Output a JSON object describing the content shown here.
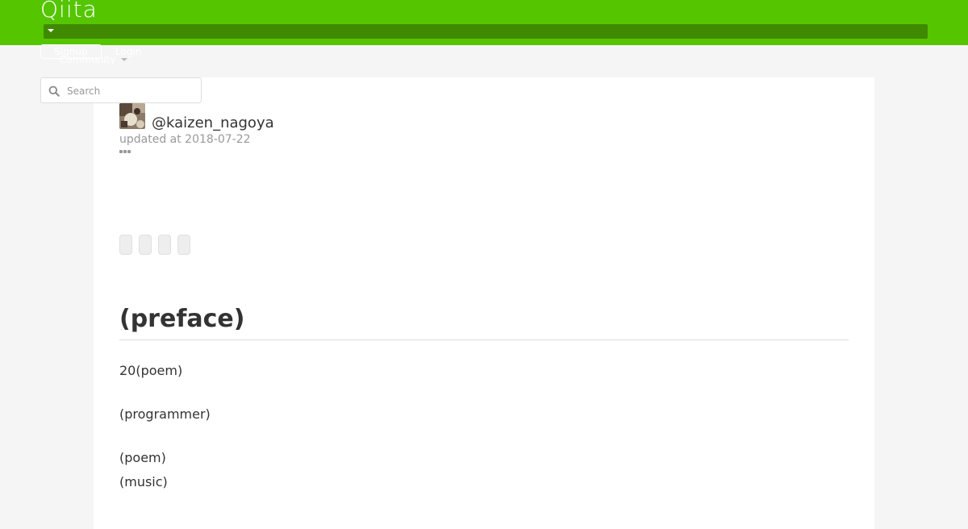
{
  "header": {
    "logo": "Qiita",
    "signup_label": "Signup",
    "login_label": "Login",
    "community_label": "Community",
    "brand_color": "#55c500"
  },
  "search": {
    "placeholder": "Search",
    "icon": "search-icon"
  },
  "article": {
    "username": "@kaizen_nagoya",
    "updated": "updated at 2018-07-22",
    "tag_count": 4,
    "heading": "(preface)",
    "paragraphs": [
      "20(poem)",
      "(programmer)",
      "(poem)",
      "(music)"
    ]
  }
}
